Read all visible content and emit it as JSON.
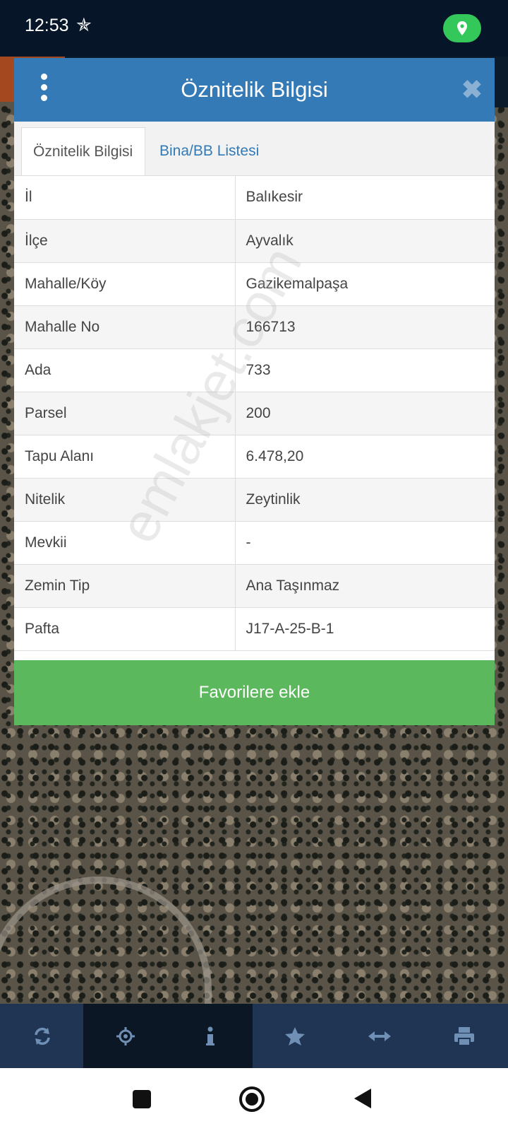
{
  "status_bar": {
    "time": "12:53",
    "star_glyph": "✯",
    "location_color": "#34c759"
  },
  "modal": {
    "title": "Öznitelik Bilgisi",
    "close_glyph": "✖",
    "tabs": [
      {
        "label": "Öznitelik Bilgisi",
        "active": true
      },
      {
        "label": "Bina/BB Listesi",
        "active": false
      }
    ],
    "rows": [
      {
        "key": "İl",
        "value": "Balıkesir"
      },
      {
        "key": "İlçe",
        "value": "Ayvalık"
      },
      {
        "key": "Mahalle/Köy",
        "value": "Gazikemalpaşa"
      },
      {
        "key": "Mahalle No",
        "value": "166713"
      },
      {
        "key": "Ada",
        "value": "733"
      },
      {
        "key": "Parsel",
        "value": "200"
      },
      {
        "key": "Tapu Alanı",
        "value": "6.478,20"
      },
      {
        "key": "Nitelik",
        "value": "Zeytinlik"
      },
      {
        "key": "Mevkii",
        "value": "-"
      },
      {
        "key": "Zemin Tip",
        "value": "Ana Taşınmaz"
      },
      {
        "key": "Pafta",
        "value": "J17-A-25-B-1"
      }
    ],
    "favorite_button": "Favorilere ekle"
  },
  "watermark": "emlakjet.com",
  "toolbar": {
    "items": [
      "refresh-icon",
      "locate-icon",
      "info-icon",
      "star-icon",
      "measure-icon",
      "print-icon"
    ],
    "active_items": [
      "locate-icon",
      "info-icon"
    ]
  },
  "colors": {
    "header": "#337ab7",
    "favorite": "#5cb85c",
    "toolbar": "#1f3553"
  }
}
